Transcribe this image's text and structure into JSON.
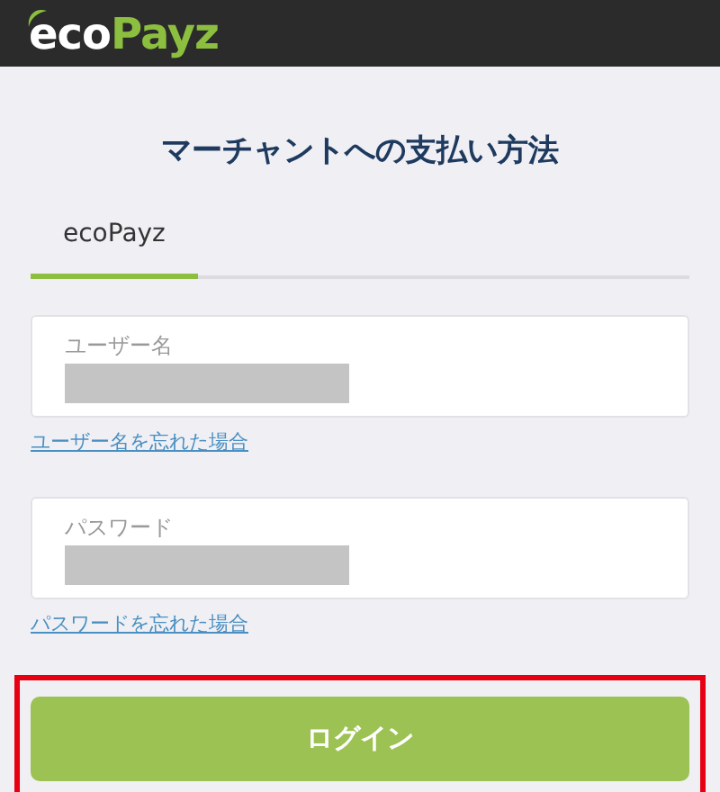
{
  "header": {
    "logo": {
      "part_1": "eco",
      "part_2": "Payz"
    }
  },
  "title": "マーチャントへの支払い方法",
  "tabs": [
    {
      "label": "ecoPayz",
      "selected": true
    }
  ],
  "fields": [
    {
      "label": "ユーザー名",
      "value_hidden": true,
      "link": "ユーザー名を忘れた場合"
    },
    {
      "label": "パスワード",
      "value_hidden": true,
      "link": "パスワードを忘れた場合"
    }
  ],
  "login_button": {
    "label": "ログイン",
    "highlighted": true
  }
}
